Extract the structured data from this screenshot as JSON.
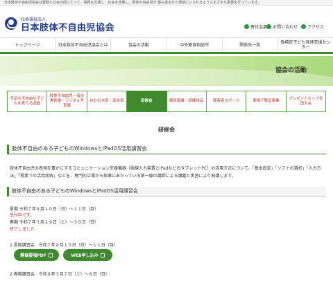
{
  "topbar": {
    "text": "日本肢体不自由児協会は業務と社会の間にたって、事務を支援し、社会を啓発し、肢体不自由児が 最も恵まれた環境にいられるようさまざまな事業を行っています。"
  },
  "header": {
    "org_sub": "社会福祉法人",
    "org_name": "日本肢体不自由児協会",
    "util": [
      "寄付金募集",
      "お問い合わせ",
      "アクセス"
    ]
  },
  "gnav": [
    "トップページ",
    "日本肢体不自由児協会とは",
    "協会の活動",
    "中央療育相談所",
    "関係先一覧",
    "板橋区子ども発達支援センター"
  ],
  "banner": {
    "title": "協会の活動"
  },
  "subnav": [
    "手足の不自由な子どもを育てる運動",
    "肢体不自由児・者の美術展・デジタル写真展",
    "ねむの木賞・高木賞",
    "研修会",
    "療育図書／訓練用品",
    "障害者スポーツ",
    "車椅子贈呈事業",
    "プレゼントカップ全国大会"
  ],
  "subnav_active": 3,
  "page_title": "研修会",
  "section": {
    "heading": "肢体不自由のある子どものWindowsとiPadOS活用講習会",
    "description": "肢体不自由児の表現を豊かにするコミュニケーション支援機器（視線入力装置とiPadなどのタブレットPC）の活用方法について、「基本設定」「ソフトの選択」「入力方法」「授業での活用実践」などを、専門的立場から指導にあたっている第一線の講師による講義と実習により発講します。",
    "subheading": "肢体不自由のある子どものWindowsとiPadOS活用講習会",
    "schedule": [
      "夏期 令和７年８月１０日（日）～１１日（月）",
      "受付中です。",
      "春期 令和７年３月２９日（土）～３０日（日）",
      "終了しました"
    ],
    "item1": "1.夏期講習会　令和７年８月１０日（日）～１１日（月）",
    "buttons": [
      "開催要項PDF",
      "WEB申し込み"
    ],
    "item2": "2.春期講習会　令和８年３月７日（土）～８日（日）"
  },
  "colors": {
    "accent": "#3f8a2f",
    "brand": "#1f3a8f",
    "alert": "#c0392b"
  }
}
